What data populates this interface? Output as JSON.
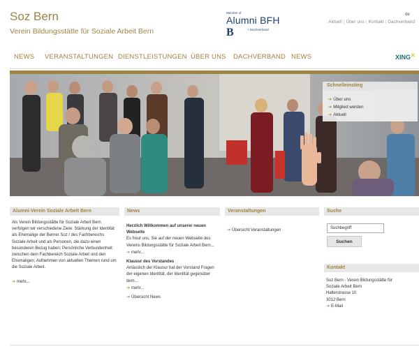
{
  "header": {
    "title": "Soz Bern",
    "subtitle": "Verein Bildungsstätte für Soziale Arbeit Bern",
    "lang": "de",
    "top_links": [
      "Aktuell",
      "Über uns",
      "Kontakt",
      "Dachverband"
    ],
    "bfh": {
      "member": "Member of",
      "alumni": "Alumni BFH",
      "b": "B",
      "dach": "+ Dachverband"
    }
  },
  "nav": {
    "items": [
      "NEWS",
      "VERANSTALTUNGEN",
      "DIENSTLEISTUNGEN",
      "ÜBER UNS",
      "DACHVERBAND",
      "NEWS"
    ],
    "xing": "XING"
  },
  "quick": {
    "title": "Schnelleinstieg",
    "items": [
      "Über uns",
      "Mitglied werden",
      "Aktuell"
    ]
  },
  "columns": {
    "alumni": {
      "title": "Alumni-Verein Soziale Arbeit Bern",
      "text": "Als Verein Bildungsstätte für Soziale Arbeit Bern verfolgen wir verschiedene Ziele: Stärkung der Identität als Ehemalige der Berner Soz / des Fachbereichs Soziale Arbeit und als Personen, die dazu einen besonderen Bezug haben; Persönliche Verbundenheit zwischen dem Fachbereich Soziale Arbeit und den Ehemaligen; Aufnehmen von aktuellen Themen rund um die Soziale Arbeit.",
      "more": "mehr..."
    },
    "news": {
      "title": "News",
      "item1_title": "Herzlich Willkommen auf unserer neuen Webseite",
      "item1_text": "Es freut uns, Sie auf der neuen Webseite des Vereins Bildungsstätte für Soziale Arbeit Bern...",
      "item1_more": "mehr...",
      "item2_title": "Klausur des Vorstandes",
      "item2_text": "Anlässlich der Klausur hat der Vorstand Fragen der eigenen Identität, der Identität gegenüber dem...",
      "item2_more": "mehr...",
      "overview": "Übersicht News"
    },
    "events": {
      "title": "Veranstaltungen",
      "overview": "Übersicht Veranstaltungen"
    },
    "search": {
      "title": "Suche",
      "placeholder": "Suchbegriff",
      "button": "Suchen"
    },
    "contact": {
      "title": "Kontakt",
      "line1": "Soz Bern - Verein Bildungsstätte für",
      "line2": "Soziale Arbeit Bern",
      "line3": "Hallerstrasse 10",
      "line4": "3012 Bern",
      "email": "E-Mail"
    }
  },
  "colors": {
    "brand": "#9c8443",
    "bfh_blue": "#1f3e72",
    "panel_grey": "#e7e7e7"
  }
}
